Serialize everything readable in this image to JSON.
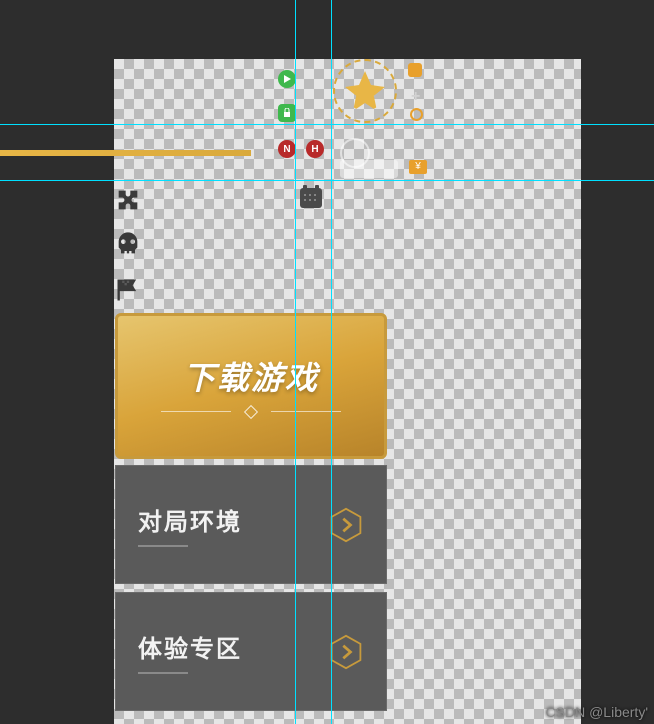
{
  "download_card": {
    "title": "下载游戏"
  },
  "menu_cards": [
    {
      "label": "对局环境"
    },
    {
      "label": "体验专区"
    }
  ],
  "badges": {
    "n": "N",
    "h": "H",
    "yen": "¥"
  },
  "watermark": "CSDN @Liberty'",
  "guides": {
    "h_positions": [
      124,
      180
    ],
    "v_positions": [
      295,
      331
    ]
  },
  "colors": {
    "gold": "#d9a43a",
    "grey_card": "#5a5a5a",
    "accent_red": "#b82a2a",
    "accent_green": "#3fb84d"
  }
}
